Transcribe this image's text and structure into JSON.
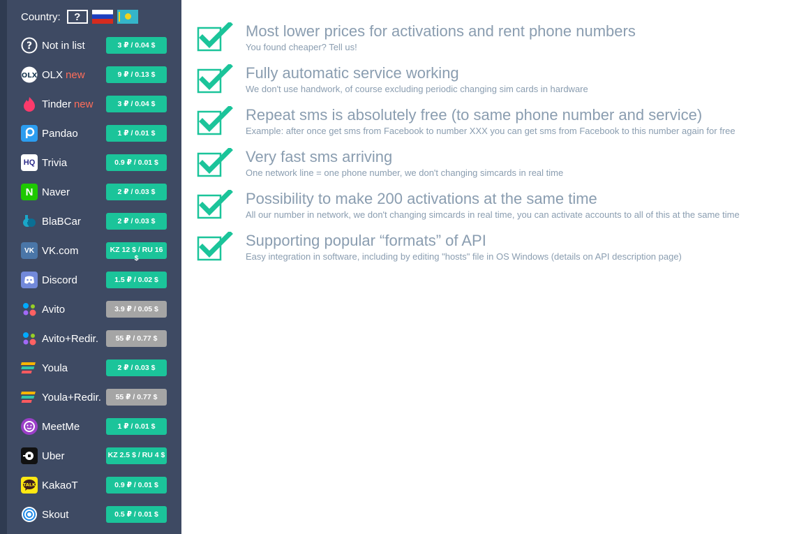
{
  "sidebar": {
    "country_label": "Country:",
    "country_unknown": "?",
    "services": [
      {
        "name": "Not in list",
        "new": "",
        "price": "3 ₽ / 0.04 $",
        "status": "active",
        "icon": "question-icon"
      },
      {
        "name": "OLX",
        "new": "new",
        "price": "9 ₽ / 0.13 $",
        "status": "active",
        "icon": "olx-icon"
      },
      {
        "name": "Tinder",
        "new": "new",
        "price": "3 ₽ / 0.04 $",
        "status": "active",
        "icon": "tinder-icon"
      },
      {
        "name": "Pandao",
        "new": "",
        "price": "1 ₽ / 0.01 $",
        "status": "active",
        "icon": "pandao-icon"
      },
      {
        "name": "Trivia",
        "new": "",
        "price": "0.9 ₽ / 0.01 $",
        "status": "active",
        "icon": "trivia-icon"
      },
      {
        "name": "Naver",
        "new": "",
        "price": "2 ₽ / 0.03 $",
        "status": "active",
        "icon": "naver-icon"
      },
      {
        "name": "BlaBCar",
        "new": "",
        "price": "2 ₽ / 0.03 $",
        "status": "active",
        "icon": "blablacar-icon"
      },
      {
        "name": "VK.com",
        "new": "",
        "price": "KZ 12 $ / RU 16 $",
        "status": "active",
        "icon": "vk-icon"
      },
      {
        "name": "Discord",
        "new": "",
        "price": "1.5 ₽ / 0.02 $",
        "status": "active",
        "icon": "discord-icon"
      },
      {
        "name": "Avito",
        "new": "",
        "price": "3.9 ₽ / 0.05 $",
        "status": "disabled",
        "icon": "avito-icon"
      },
      {
        "name": "Avito+Redir.",
        "new": "",
        "price": "55 ₽ / 0.77 $",
        "status": "disabled",
        "icon": "avito-icon"
      },
      {
        "name": "Youla",
        "new": "",
        "price": "2 ₽ / 0.03 $",
        "status": "active",
        "icon": "youla-icon"
      },
      {
        "name": "Youla+Redir.",
        "new": "",
        "price": "55 ₽ / 0.77 $",
        "status": "disabled",
        "icon": "youla-icon"
      },
      {
        "name": "MeetMe",
        "new": "",
        "price": "1 ₽ / 0.01 $",
        "status": "active",
        "icon": "meetme-icon"
      },
      {
        "name": "Uber",
        "new": "",
        "price": "KZ 2.5 $ / RU 4 $",
        "status": "active",
        "icon": "uber-icon"
      },
      {
        "name": "KakaoT",
        "new": "",
        "price": "0.9 ₽ / 0.01 $",
        "status": "active",
        "icon": "kakaotalk-icon"
      },
      {
        "name": "Skout",
        "new": "",
        "price": "0.5 ₽ / 0.01 $",
        "status": "active",
        "icon": "skout-icon"
      }
    ]
  },
  "features": [
    {
      "title": "Most lower prices for activations and rent phone numbers",
      "desc": "You found cheaper? Tell us!"
    },
    {
      "title": "Fully automatic service working",
      "desc": "We don't use handwork, of course excluding periodic changing sim cards in hardware"
    },
    {
      "title": "Repeat sms is absolutely free (to same phone number and service)",
      "desc": "Example: after once get sms from Facebook to number XXX you can get sms from Facebook to this number again for free"
    },
    {
      "title": "Very fast sms arriving",
      "desc": "One network line = one phone number, we don't changing simcards in real time"
    },
    {
      "title": "Possibility to make 200 activations at the same time",
      "desc": "All our number in network, we don't changing simcards in real time, you can activate accounts to all of this at the same time"
    },
    {
      "title": "Supporting popular “formats” of API",
      "desc": "Easy integration in software, including by editing \"hosts\" file in OS Windows (details on API description page)"
    }
  ],
  "colors": {
    "sidebar_bg": "#3e4a63",
    "price_active": "#1bc49a",
    "price_disabled": "#a5a5a5",
    "new_badge": "#ff6e5a",
    "check": "#1bc49a",
    "feature_text": "#8a9db0"
  }
}
